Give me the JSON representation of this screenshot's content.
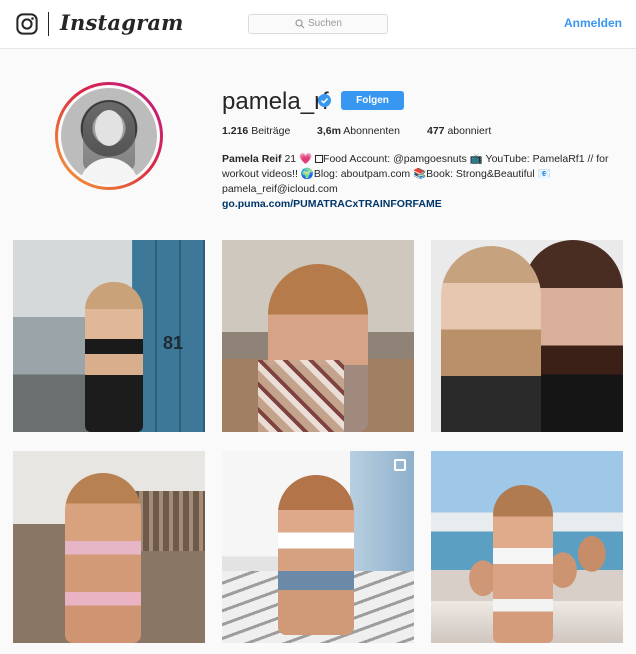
{
  "nav": {
    "wordmark": "Instagram",
    "search_placeholder": "Suchen",
    "login_label": "Anmelden"
  },
  "profile": {
    "username": "pamela_rf",
    "follow_label": "Folgen",
    "stats": {
      "posts_count": "1.216",
      "posts_label": "Beiträge",
      "followers_count": "3,6m",
      "followers_label": "Abonnenten",
      "following_count": "477",
      "following_label": "abonniert"
    },
    "bio": {
      "name": "Pamela Reif",
      "line1_rest": " 21 ",
      "line1_food": "Food Account: @pamgoesnuts ",
      "line1_yt": "YouTube: PamelaRf1 // for",
      "line2": "workout videos!! 🌍Blog: aboutpam.com 📚Book: Strong&Beautiful 📧",
      "line3": "pamela_reif@icloud.com",
      "link": "go.puma.com/PUMATRACxTRAINFORFAME"
    }
  },
  "icons": {
    "instagram": "instagram-camera-icon",
    "search": "search-icon",
    "verified": "verified-badge-icon",
    "multi": "multiple-photos-icon"
  },
  "colors": {
    "accent": "#3897f0",
    "link": "#003569",
    "ring_start": "#f9a337",
    "ring_end": "#bc1888"
  }
}
